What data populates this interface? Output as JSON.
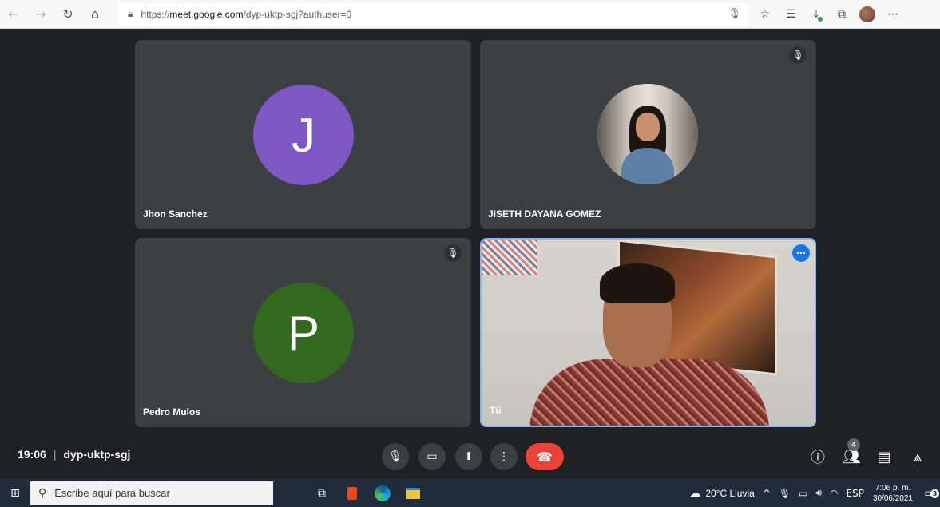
{
  "browser": {
    "url_prefix": "https://",
    "url_host": "meet.google.com",
    "url_path": "/dyp-uktp-sgj?authuser=0"
  },
  "meeting": {
    "time": "19:06",
    "code": "dyp-uktp-sgj",
    "people_count": "4"
  },
  "participants": [
    {
      "name": "Jhon Sanchez",
      "initial": "J",
      "avatar_color": "#7e57c2",
      "muted": false
    },
    {
      "name": "JISETH DAYANA GOMEZ",
      "initial": "",
      "avatar_color": "",
      "muted": true
    },
    {
      "name": "Pedro Mulos",
      "initial": "P",
      "avatar_color": "#33691e",
      "muted": true
    },
    {
      "name": "Tú",
      "initial": "",
      "avatar_color": "",
      "muted": false
    }
  ],
  "taskbar": {
    "search_placeholder": "Escribe aquí para buscar",
    "weather": "20°C  Lluvia",
    "language": "ESP",
    "clock_time": "7:06 p. m.",
    "clock_date": "30/06/2021",
    "notification_count": "3"
  },
  "colors": {
    "end_call": "#ea4335",
    "self_tile_border": "#8ab4f8",
    "more_button": "#1a73e8"
  }
}
